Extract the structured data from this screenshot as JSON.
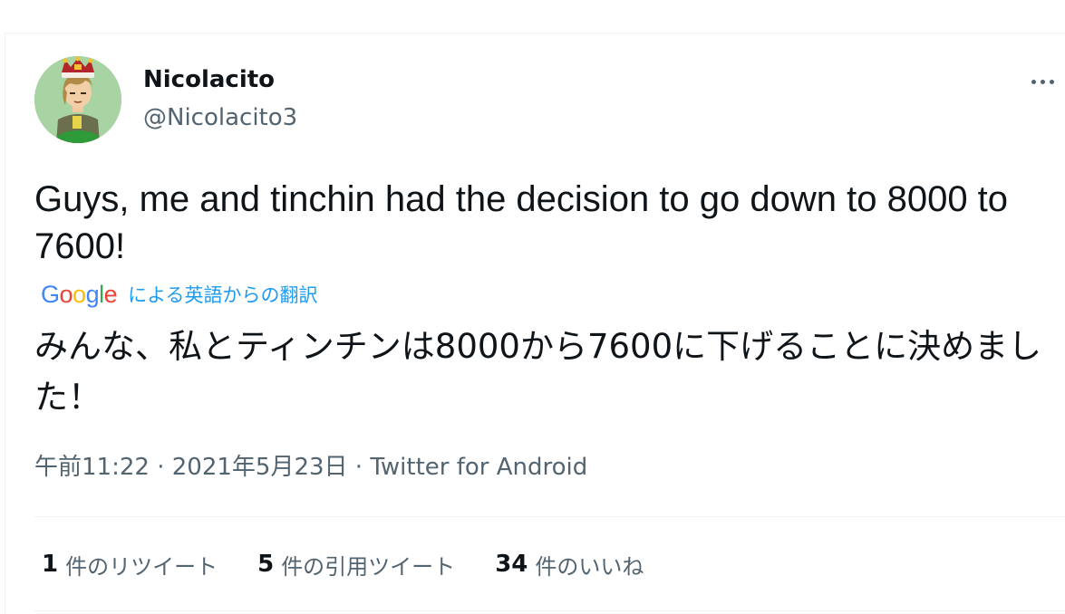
{
  "user": {
    "display_name": "Nicolacito",
    "handle": "@Nicolacito3"
  },
  "tweet": {
    "text": "Guys, me and tinchin had the decision to go down to 8000 to 7600!",
    "translation_label": "による英語からの翻訳",
    "translated_text": "みんな、私とティンチンは8000から7600に下げることに決めました！",
    "time": "午前11:22",
    "date": "2021年5月23日",
    "source": "Twitter for Android",
    "separator": "·"
  },
  "stats": {
    "retweets_count": "1",
    "retweets_label": "件のリツイート",
    "quotes_count": "5",
    "quotes_label": "件の引用ツイート",
    "likes_count": "34",
    "likes_label": "件のいいね"
  },
  "google_logo": {
    "letters": [
      "G",
      "o",
      "o",
      "g",
      "l",
      "e"
    ],
    "colors": [
      "#4285f4",
      "#ea4335",
      "#fbbc05",
      "#4285f4",
      "#34a853",
      "#ea4335"
    ]
  },
  "colors": {
    "text_primary": "#0f1419",
    "text_secondary": "#536471",
    "link": "#1d9bf0",
    "divider": "#eff3f4",
    "avatar_bg": "#a8d3a2"
  },
  "icons": {
    "more": "more-horizontal-icon",
    "avatar": "avatar-image"
  }
}
